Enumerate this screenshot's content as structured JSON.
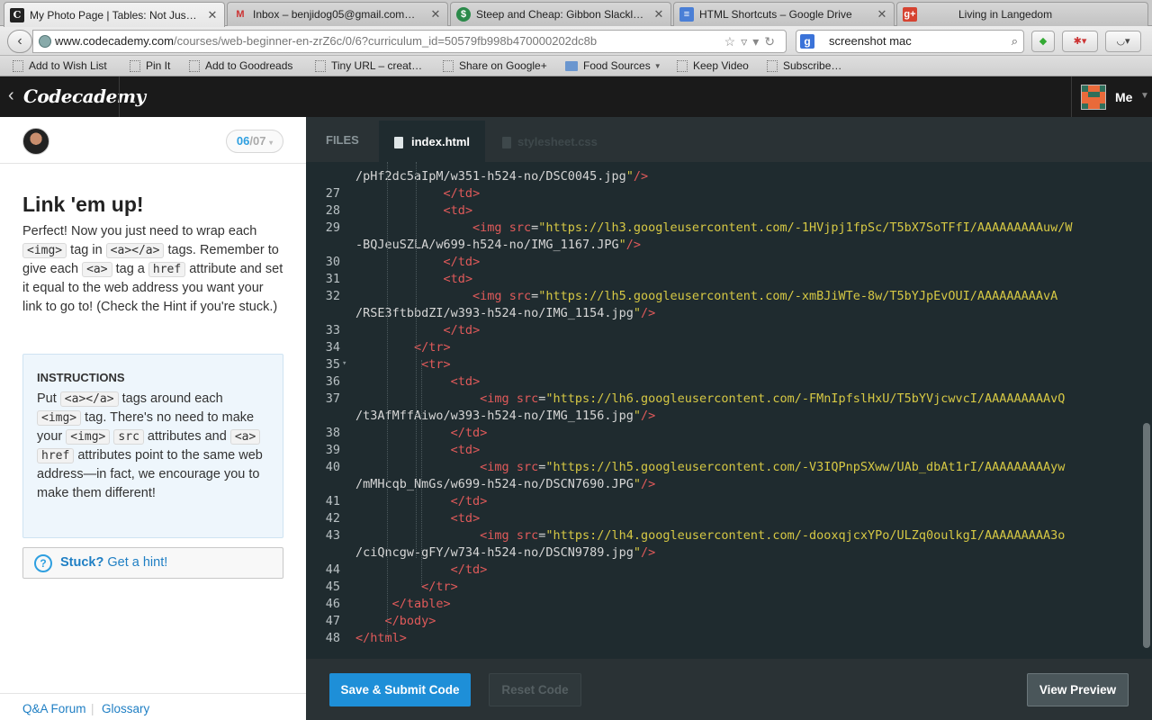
{
  "browser": {
    "tabs": [
      {
        "title": "My Photo Page | Tables: Not Jus…",
        "icon": "codecademy-favicon",
        "active": true
      },
      {
        "title": "Inbox – benjidog05@gmail.com…",
        "icon": "gmail-favicon"
      },
      {
        "title": "Steep and Cheap: Gibbon Slackl…",
        "icon": "steepandcheap-favicon"
      },
      {
        "title": "HTML Shortcuts – Google Drive",
        "icon": "google-drive-favicon"
      },
      {
        "title": "Living in Langedom",
        "icon": "google-plus-favicon"
      }
    ],
    "url_host": "www.codecademy.com",
    "url_path": "/courses/web-beginner-en-zrZ6c/0/6?curriculum_id=50579fb998b470000202dc8b",
    "search_query": "screenshot mac",
    "bookmarks": [
      "Add to Wish List",
      "Pin It",
      "Add to Goodreads",
      "Tiny URL – creat…",
      "Share on Google+",
      "Food Sources",
      "Keep Video",
      "Subscribe…"
    ]
  },
  "header": {
    "logo": "Codecademy",
    "user": "Me"
  },
  "lesson": {
    "progress_current": "06",
    "progress_total": "/07",
    "title": "Link 'em up!",
    "body": [
      "Perfect! Now you just need to wrap each ",
      "<img>",
      " tag in ",
      "<a></a>",
      " tags. Remember to give each ",
      "<a>",
      " tag a ",
      "href",
      " attribute and set it equal to the web address you want your link to go to! (Check the Hint if you're stuck.)"
    ],
    "instructions_heading": "INSTRUCTIONS",
    "instructions": [
      "Put ",
      "<a></a>",
      " tags around each ",
      "<img>",
      " tag. There's no need to make your ",
      "<img>",
      " ",
      "src",
      " attributes and ",
      "<a>",
      " ",
      "href",
      " attributes point to the same web address—in fact, we encourage you to make them different!"
    ],
    "hint_strong": "Stuck?",
    "hint_text": " Get a hint!",
    "footer_links": [
      "Q&A Forum",
      "Glossary"
    ]
  },
  "editor": {
    "files_label": "FILES",
    "active_file": "index.html",
    "other_file": "stylesheet.css",
    "save_button": "Save & Submit Code",
    "reset_button": "Reset Code",
    "preview_button": "View Preview",
    "lines": [
      {
        "n": "",
        "text": "/pHf2dc5aIpM/w351-h524-no/DSC0045.jpg\"/>"
      },
      {
        "n": "27",
        "text": "            </td>"
      },
      {
        "n": "28",
        "text": "            <td>"
      },
      {
        "n": "29",
        "text": "                <img src=\"https://lh3.googleusercontent.com/-1HVjpj1fpSc/T5bX7SoTFfI/AAAAAAAAAuw/W"
      },
      {
        "n": "",
        "text": "-BQJeuSZLA/w699-h524-no/IMG_1167.JPG\"/>"
      },
      {
        "n": "30",
        "text": "            </td>"
      },
      {
        "n": "31",
        "text": "            <td>"
      },
      {
        "n": "32",
        "text": "                <img src=\"https://lh5.googleusercontent.com/-xmBJiWTe-8w/T5bYJpEvOUI/AAAAAAAAAvA"
      },
      {
        "n": "",
        "text": "/RSE3ftbbdZI/w393-h524-no/IMG_1154.jpg\"/>"
      },
      {
        "n": "33",
        "text": "            </td>"
      },
      {
        "n": "34",
        "text": "        </tr>"
      },
      {
        "n": "35",
        "text": "         <tr>"
      },
      {
        "n": "36",
        "text": "             <td>"
      },
      {
        "n": "37",
        "text": "                 <img src=\"https://lh6.googleusercontent.com/-FMnIpfslHxU/T5bYVjcwvcI/AAAAAAAAAvQ"
      },
      {
        "n": "",
        "text": "/t3AfMffAiwo/w393-h524-no/IMG_1156.jpg\"/>"
      },
      {
        "n": "38",
        "text": "             </td>"
      },
      {
        "n": "39",
        "text": "             <td>"
      },
      {
        "n": "40",
        "text": "                 <img src=\"https://lh5.googleusercontent.com/-V3IQPnpSXww/UAb_dbAt1rI/AAAAAAAAAyw"
      },
      {
        "n": "",
        "text": "/mMHcqb_NmGs/w699-h524-no/DSCN7690.JPG\"/>"
      },
      {
        "n": "41",
        "text": "             </td>"
      },
      {
        "n": "42",
        "text": "             <td>"
      },
      {
        "n": "43",
        "text": "                 <img src=\"https://lh4.googleusercontent.com/-dooxqjcxYPo/ULZq0oulkgI/AAAAAAAAA3o"
      },
      {
        "n": "",
        "text": "/ciQncgw-gFY/w734-h524-no/DSCN9789.jpg\"/>"
      },
      {
        "n": "44",
        "text": "             </td>"
      },
      {
        "n": "45",
        "text": "         </tr>"
      },
      {
        "n": "46",
        "text": "     </table>"
      },
      {
        "n": "47",
        "text": "    </body>"
      },
      {
        "n": "48",
        "text": "</html>"
      }
    ]
  },
  "colors": {
    "accent": "#1e8fd8",
    "editor_bg": "#1f2b2f",
    "tag_color": "#e05a5a",
    "string_color": "#d6c844"
  }
}
